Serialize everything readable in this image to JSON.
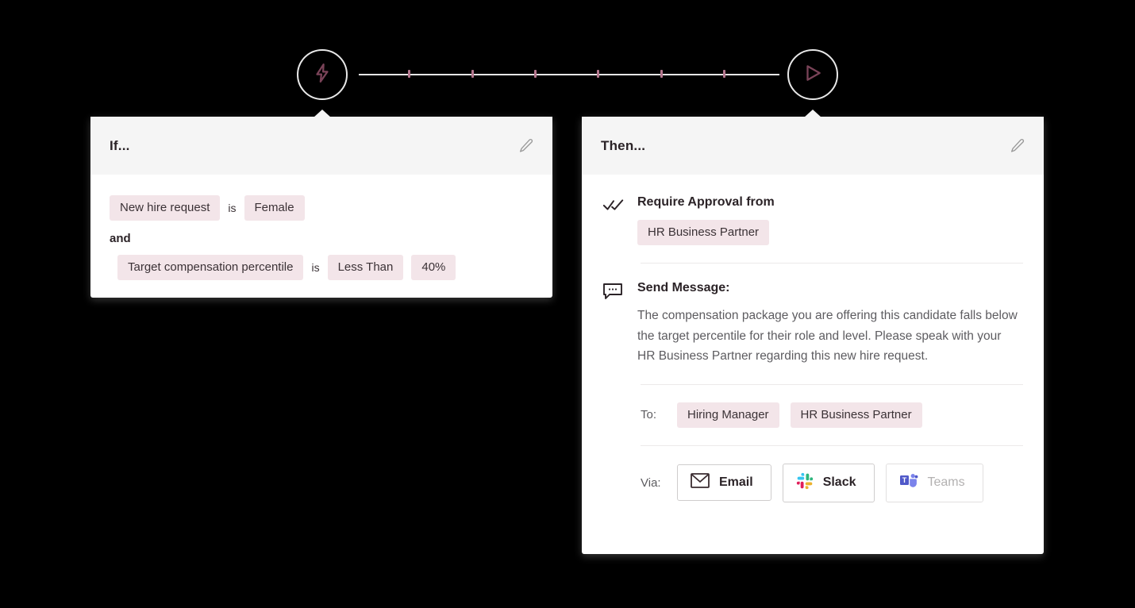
{
  "flow": {
    "trigger_icon": "lightning-bolt-icon",
    "action_icon": "play-triangle-icon",
    "tick_count": 6,
    "line_color": "#e6e6e6",
    "tick_color": "#b5788f"
  },
  "if_card": {
    "title": "If...",
    "edit_icon": "pencil-icon",
    "conditions": [
      {
        "subject": "New hire request",
        "operator": "is",
        "value": "Female"
      }
    ],
    "joiner": "and",
    "second_condition": {
      "subject": "Target compensation percentile",
      "operator": "is",
      "comparator": "Less Than",
      "value": "40%"
    }
  },
  "then_card": {
    "title": "Then...",
    "edit_icon": "pencil-icon",
    "approval": {
      "icon": "double-check-icon",
      "title": "Require Approval from",
      "approvers": [
        "HR Business Partner"
      ]
    },
    "message": {
      "icon": "speech-bubble-icon",
      "title": "Send Message:",
      "body": "The compensation package you are offering this candidate falls below the target percentile for their role and level. Please speak with your HR Business Partner regarding this new hire request."
    },
    "to": {
      "label": "To:",
      "recipients": [
        "Hiring Manager",
        "HR Business Partner"
      ]
    },
    "via": {
      "label": "Via:",
      "channels": [
        {
          "name": "Email",
          "icon": "envelope-icon",
          "selected": true
        },
        {
          "name": "Slack",
          "icon": "slack-icon",
          "selected": true
        },
        {
          "name": "Teams",
          "icon": "teams-icon",
          "selected": false
        }
      ]
    }
  },
  "colors": {
    "background": "#000000",
    "card": "#ffffff",
    "header": "#f5f5f5",
    "pill": "#f3e5e9",
    "accent": "#b5788f",
    "text_dark": "#2b2327",
    "text_muted": "#5d5c60"
  }
}
